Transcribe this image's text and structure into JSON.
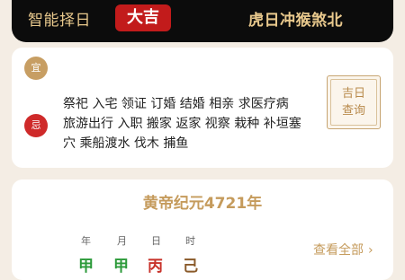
{
  "header": {
    "title": "智能择日",
    "badge": "大吉",
    "clash": "虎日冲猴煞北"
  },
  "auspicious": {
    "yi_label": "宜",
    "ji_label": "忌",
    "ji_text": "祭祀 入宅 领证 订婚 结婚 相亲 求医疗病\n旅游出行 入职 搬家 返家 视察 栽种 补垣塞\n穴 乘船渡水 伐木 捕鱼",
    "query_button": "吉日\n查询"
  },
  "calendar": {
    "era": "黄帝纪元4721年",
    "pillars": [
      {
        "label": "年",
        "value": "甲",
        "color": "#2c9a3a"
      },
      {
        "label": "月",
        "value": "甲",
        "color": "#2c9a3a"
      },
      {
        "label": "日",
        "value": "丙",
        "color": "#c8322a"
      },
      {
        "label": "时",
        "value": "己",
        "color": "#8a5a2a"
      }
    ],
    "view_all": "查看全部"
  }
}
